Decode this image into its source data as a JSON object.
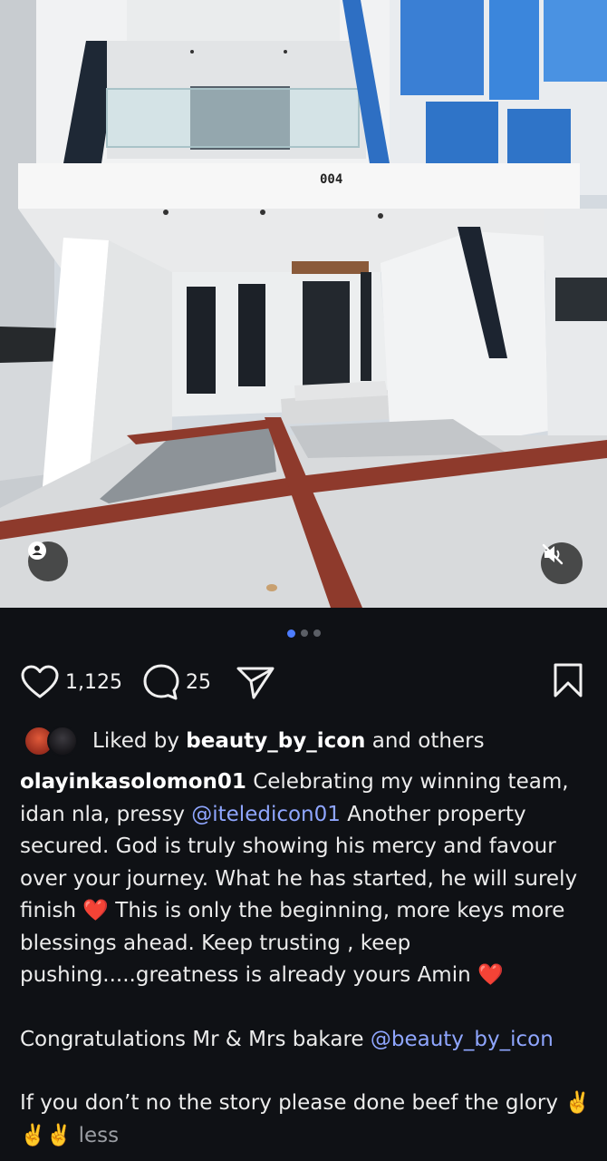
{
  "photo": {
    "house_number": "004",
    "alt_description": ""
  },
  "carousel": {
    "total": 3,
    "active": 0
  },
  "actions": {
    "like_count": "1,125",
    "comment_count": "25"
  },
  "liked_by": {
    "prefix": "Liked by",
    "user": "beauty_by_icon",
    "suffix": "and others"
  },
  "caption": {
    "username": "olayinkasolomon01",
    "text_1": " Celebrating my winning team, idan nla, pressy ",
    "mention_1": "@iteledicon01",
    "text_2": " Another property secured. God is truly showing his mercy and favour over your journey. What he has started, he will surely finish ",
    "heart_1": "❤️",
    "text_3": " This is only the beginning, more keys more blessings ahead. Keep trusting , keep pushing.....greatness is already yours Amin ",
    "heart_2": "❤️",
    "text_4": "Congratulations Mr & Mrs bakare ",
    "mention_2": "@beauty_by_icon",
    "text_5": "If you don’t no the story please done beef the glory",
    "emoji_end": "✌️✌️✌️",
    "less_label": "less"
  },
  "icons": {
    "like": "heart-outline-icon",
    "comment": "comment-bubble-icon",
    "share": "paper-plane-icon",
    "save": "bookmark-icon",
    "user": "user-tag-icon",
    "mute": "speaker-muted-icon"
  },
  "colors": {
    "background": "#0f1115",
    "mention": "#8fa6ff",
    "active_dot": "#4d7dff",
    "heart": "#e0202a"
  }
}
